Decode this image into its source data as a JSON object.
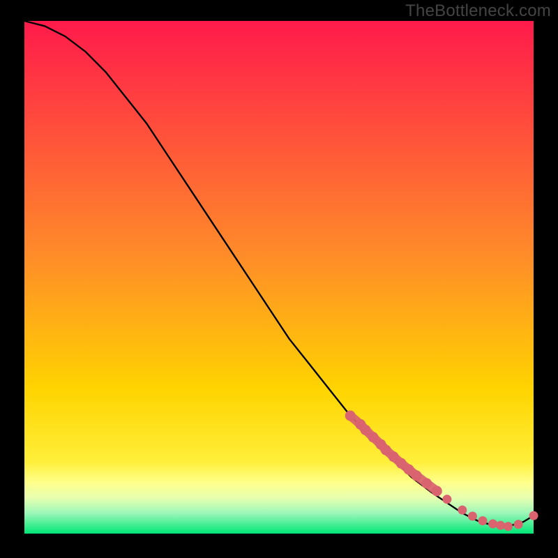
{
  "watermark": "TheBottleneck.com",
  "chart_data": {
    "type": "line",
    "title": "",
    "xlabel": "",
    "ylabel": "",
    "xlim": [
      0,
      100
    ],
    "ylim": [
      0,
      100
    ],
    "grid": false,
    "legend": false,
    "background_gradient": {
      "top_color": "#ff1a4b",
      "mid_color": "#ffd400",
      "band_color": "#ffff8a",
      "bottom_color": "#00e676"
    },
    "series": [
      {
        "name": "bottleneck-curve",
        "type": "line",
        "color": "#000000",
        "x": [
          0,
          4,
          8,
          12,
          16,
          20,
          24,
          28,
          32,
          36,
          40,
          44,
          48,
          52,
          56,
          60,
          64,
          68,
          72,
          76,
          80,
          83,
          86,
          89,
          92,
          95,
          98,
          100
        ],
        "y": [
          100,
          99,
          97,
          94,
          90,
          85,
          80,
          74,
          68,
          62,
          56,
          50,
          44,
          38,
          33,
          28,
          23,
          19,
          15,
          11,
          8,
          6,
          4,
          2.5,
          1.6,
          1.4,
          2.3,
          3.5
        ]
      },
      {
        "name": "highlighted-points",
        "type": "scatter",
        "color": "#d9636e",
        "x": [
          64,
          66,
          67,
          68.5,
          70,
          71,
          72.5,
          74,
          75.5,
          77,
          79,
          81,
          83,
          86,
          88,
          90,
          92,
          93.5,
          95,
          97,
          100
        ],
        "y": [
          23,
          21.3,
          20.2,
          18.8,
          17.4,
          16.3,
          15,
          13.7,
          12.5,
          11.3,
          9.8,
          8.3,
          6.7,
          4.6,
          3.4,
          2.5,
          1.9,
          1.6,
          1.4,
          1.8,
          3.5
        ]
      }
    ]
  }
}
